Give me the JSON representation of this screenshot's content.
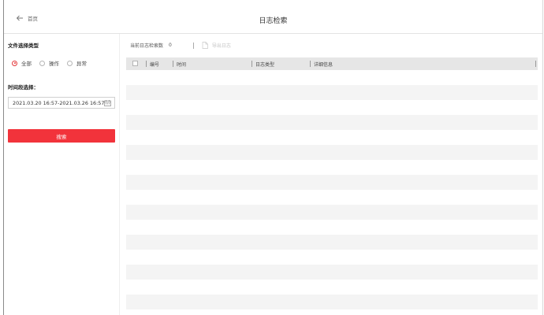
{
  "header": {
    "back_label": "首页",
    "title": "日志检索"
  },
  "sidebar": {
    "file_type_title": "文件选择类型",
    "file_types": [
      {
        "label": "全部",
        "checked": true
      },
      {
        "label": "操作",
        "checked": false
      },
      {
        "label": "异常",
        "checked": false
      }
    ],
    "time_title": "时间段选择：",
    "time_range": "2021.03.20 16:57-2021.03.26 16:57",
    "search_label": "搜索"
  },
  "toolbar": {
    "count_label": "当前日志检索数",
    "count_value": "0",
    "export_label": "导出日志"
  },
  "table": {
    "columns": [
      "编号",
      "时间",
      "日志类型",
      "详细信息"
    ],
    "row_count": 16
  },
  "colors": {
    "accent": "#f2333b",
    "header_bg": "#e6e6e6",
    "stripe": "#f4f4f4"
  }
}
